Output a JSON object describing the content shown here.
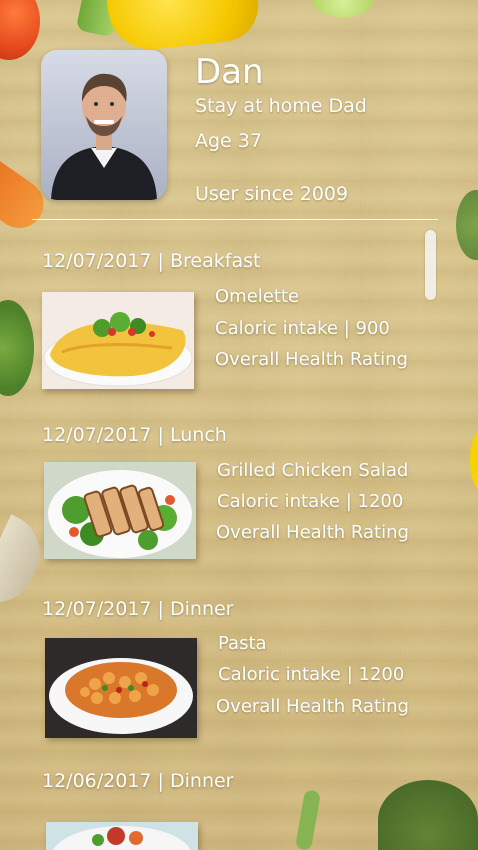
{
  "profile": {
    "name": "Dan",
    "tagline": "Stay at home Dad",
    "age": "Age 37",
    "since": "User since 2009"
  },
  "meals": [
    {
      "header": "12/07/2017 | Breakfast",
      "title": "Omelette",
      "calories": "Caloric intake | 900",
      "rating": "Overall Health Rating"
    },
    {
      "header": "12/07/2017 | Lunch",
      "title": "Grilled Chicken Salad",
      "calories": "Caloric intake | 1200",
      "rating": "Overall Health Rating"
    },
    {
      "header": "12/07/2017 | Dinner",
      "title": "Pasta",
      "calories": "Caloric intake | 1200",
      "rating": "Overall Health Rating"
    },
    {
      "header": "12/06/2017 | Dinner"
    }
  ],
  "colors": {
    "text": "#ffffff",
    "background": "#d8c48d"
  }
}
